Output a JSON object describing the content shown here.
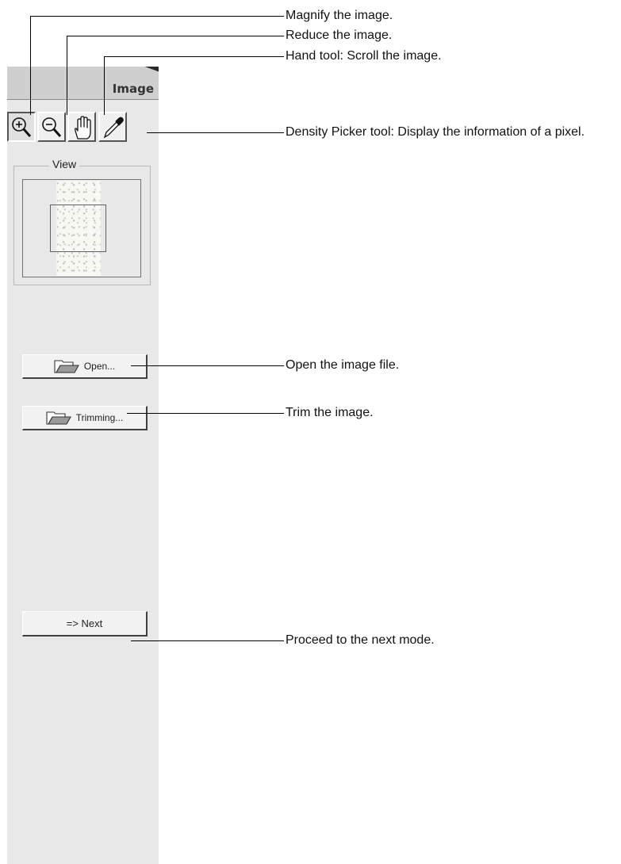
{
  "panel": {
    "title": "Image",
    "view_group_label": "View"
  },
  "tools": [
    {
      "name": "magnify-tool",
      "icon": "magnify-plus-icon",
      "pressed": true
    },
    {
      "name": "reduce-tool",
      "icon": "magnify-minus-icon",
      "pressed": false
    },
    {
      "name": "hand-tool",
      "icon": "hand-icon",
      "pressed": false
    },
    {
      "name": "density-picker-tool",
      "icon": "eyedropper-icon",
      "pressed": false
    }
  ],
  "buttons": {
    "open_label": "Open...",
    "trimming_label": "Trimming...",
    "next_label": "=> Next"
  },
  "annotations": {
    "magnify": "Magnify the image.",
    "reduce": "Reduce the image.",
    "hand": "Hand tool: Scroll the image.",
    "density": "Density Picker tool: Display the information of a pixel.",
    "open": "Open the image file.",
    "trim": "Trim the image.",
    "next": "Proceed to the next mode."
  }
}
